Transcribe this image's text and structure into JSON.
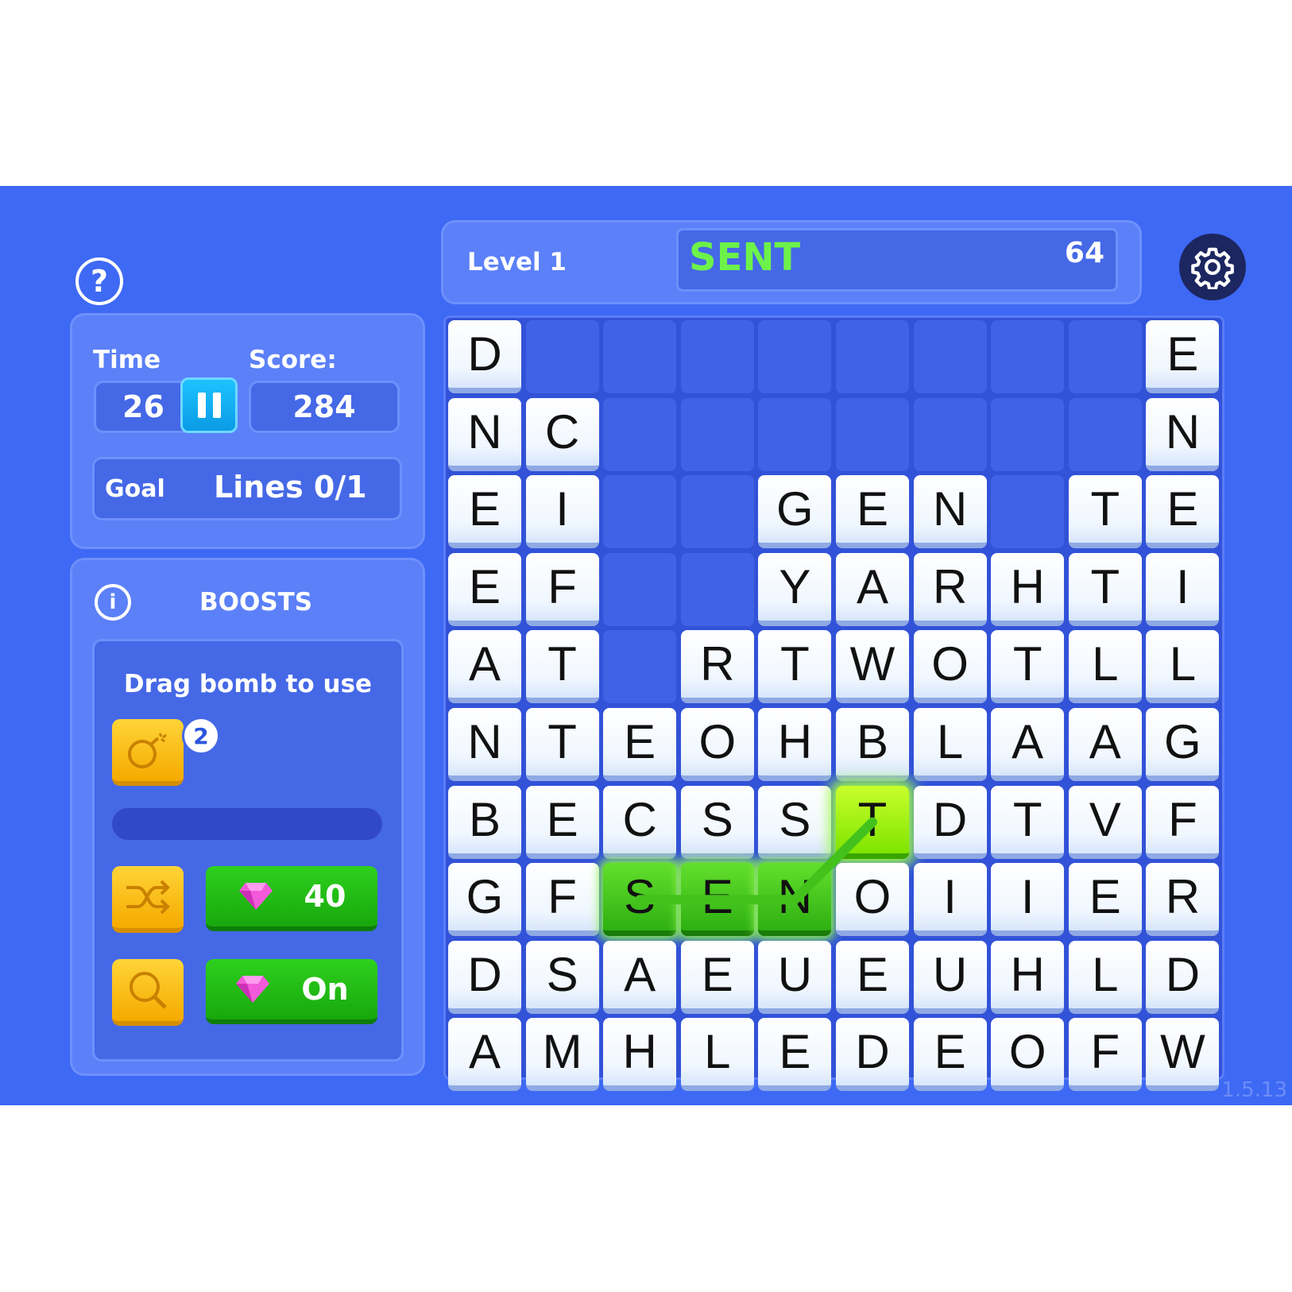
{
  "colors": {
    "background": "#3e69f4",
    "panel": "#5b80f8",
    "inset": "#4568e6",
    "tile": "#ffffff",
    "empty_cell": "#4062e4",
    "selected_tile": "#3ccb18",
    "last_selected_tile": "#a8ff1a",
    "word_highlight": "#6df24a",
    "boost_button": "#ffc21a",
    "buy_button": "#22bf15",
    "pause_button": "#14adf2",
    "settings_button": "#1c2660"
  },
  "icons": {
    "help": "question-mark-circle",
    "pause": "pause",
    "settings": "gear",
    "info": "info-circle",
    "bomb": "bomb",
    "shuffle": "shuffle-arrows",
    "search": "magnifying-glass",
    "gem": "pink-diamond"
  },
  "help_label": "?",
  "stats": {
    "time_label": "Time",
    "time_value": "26",
    "score_label": "Score:",
    "score_value": "284",
    "goal_label": "Goal",
    "goal_value": "Lines 0/1"
  },
  "boosts": {
    "title": "BOOSTS",
    "info_label": "i",
    "drag_hint": "Drag bomb to use",
    "bomb_count": "2",
    "bomb_progress": 0,
    "shuffle_price": "40",
    "hint_status": "On"
  },
  "header": {
    "level": "Level 1",
    "current_word": "SENT",
    "word_points": "64"
  },
  "board": {
    "rows": [
      "D........E",
      "NC.......N",
      "EI..GEN.TE",
      "EF..YARHTI",
      "AT.RTWOTLL",
      "NTEOHBLAAG",
      "BECSSTDTVF",
      "GFSENOIIER",
      "DSAEUEUHLD",
      "AMHLEDEOFW"
    ],
    "selected_path": [
      [
        7,
        2
      ],
      [
        7,
        3
      ],
      [
        7,
        4
      ],
      [
        6,
        5
      ]
    ]
  },
  "version": "1.5.13"
}
